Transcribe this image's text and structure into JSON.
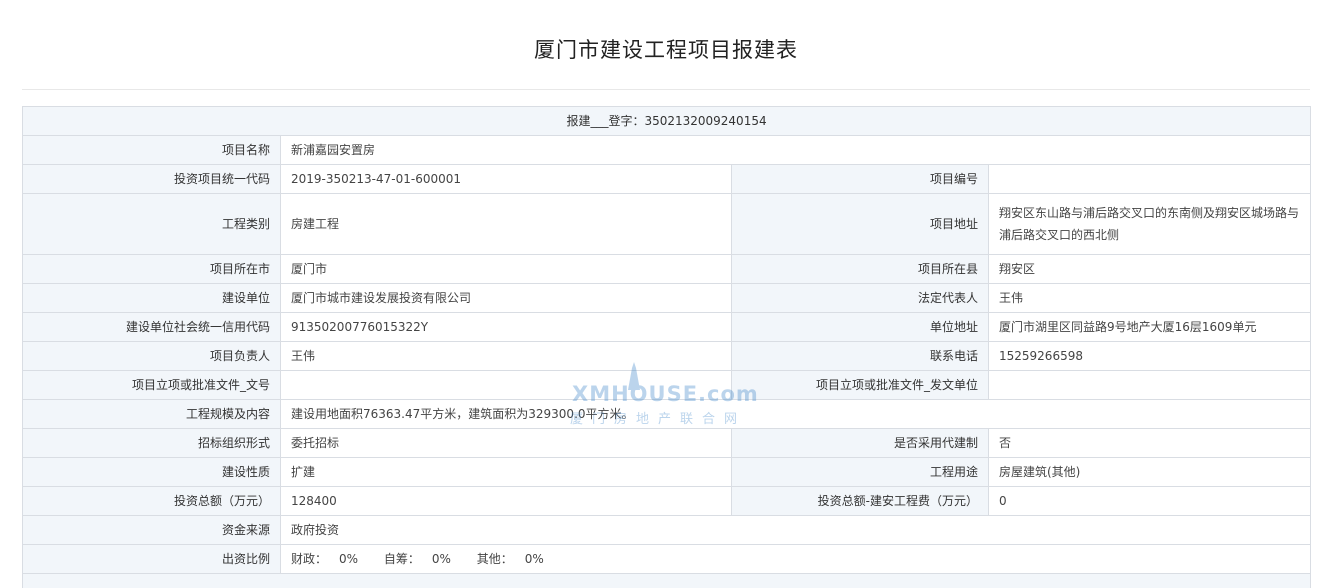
{
  "title": "厦门市建设工程项目报建表",
  "header": {
    "registration": "报建___登字：3502132009240154"
  },
  "rows": {
    "project_name": {
      "label": "项目名称",
      "value": "新浦嘉园安置房"
    },
    "invest_code": {
      "label": "投资项目统一代码",
      "value": "2019-350213-47-01-600001"
    },
    "project_no": {
      "label": "项目编号",
      "value": ""
    },
    "eng_category": {
      "label": "工程类别",
      "value": "房建工程"
    },
    "project_address": {
      "label": "项目地址",
      "value": "翔安区东山路与浦后路交叉口的东南侧及翔安区城场路与浦后路交叉口的西北侧"
    },
    "project_city": {
      "label": "项目所在市",
      "value": "厦门市"
    },
    "project_county": {
      "label": "项目所在县",
      "value": "翔安区"
    },
    "builder": {
      "label": "建设单位",
      "value": "厦门市城市建设发展投资有限公司"
    },
    "legal_rep": {
      "label": "法定代表人",
      "value": "王伟"
    },
    "credit_code": {
      "label": "建设单位社会统一信用代码",
      "value": "91350200776015322Y"
    },
    "unit_address": {
      "label": "单位地址",
      "value": "厦门市湖里区同益路9号地产大厦16层1609单元"
    },
    "project_leader": {
      "label": "项目负责人",
      "value": "王伟"
    },
    "phone": {
      "label": "联系电话",
      "value": "15259266598"
    },
    "approval_doc_no": {
      "label": "项目立项或批准文件_文号",
      "value": ""
    },
    "approval_doc_unit": {
      "label": "项目立项或批准文件_发文单位",
      "value": ""
    },
    "scale": {
      "label": "工程规模及内容",
      "value": "建设用地面积76363.47平方米，建筑面积为329300.0平方米。"
    },
    "bid_form": {
      "label": "招标组织形式",
      "value": "委托招标"
    },
    "agent_build": {
      "label": "是否采用代建制",
      "value": "否"
    },
    "nature": {
      "label": "建设性质",
      "value": "扩建"
    },
    "usage": {
      "label": "工程用途",
      "value": "房屋建筑(其他)"
    },
    "total_invest": {
      "label": "投资总额（万元）",
      "value": "128400"
    },
    "construct_fee": {
      "label": "投资总额-建安工程费（万元）",
      "value": "0"
    },
    "fund_source": {
      "label": "资金来源",
      "value": "政府投资"
    },
    "ratio": {
      "label": "出资比例",
      "items": [
        {
          "label": "财政：",
          "value": "0%"
        },
        {
          "label": "自筹：",
          "value": "0%"
        },
        {
          "label": "其他：",
          "value": "0%"
        }
      ]
    }
  },
  "watermark": {
    "main": "XMHOUSE.com",
    "sub": "厦门房地产联合网"
  },
  "colors": {
    "label_bg": "#f2f6fa",
    "border": "#d9dde3",
    "watermark": "#3f86c9"
  }
}
